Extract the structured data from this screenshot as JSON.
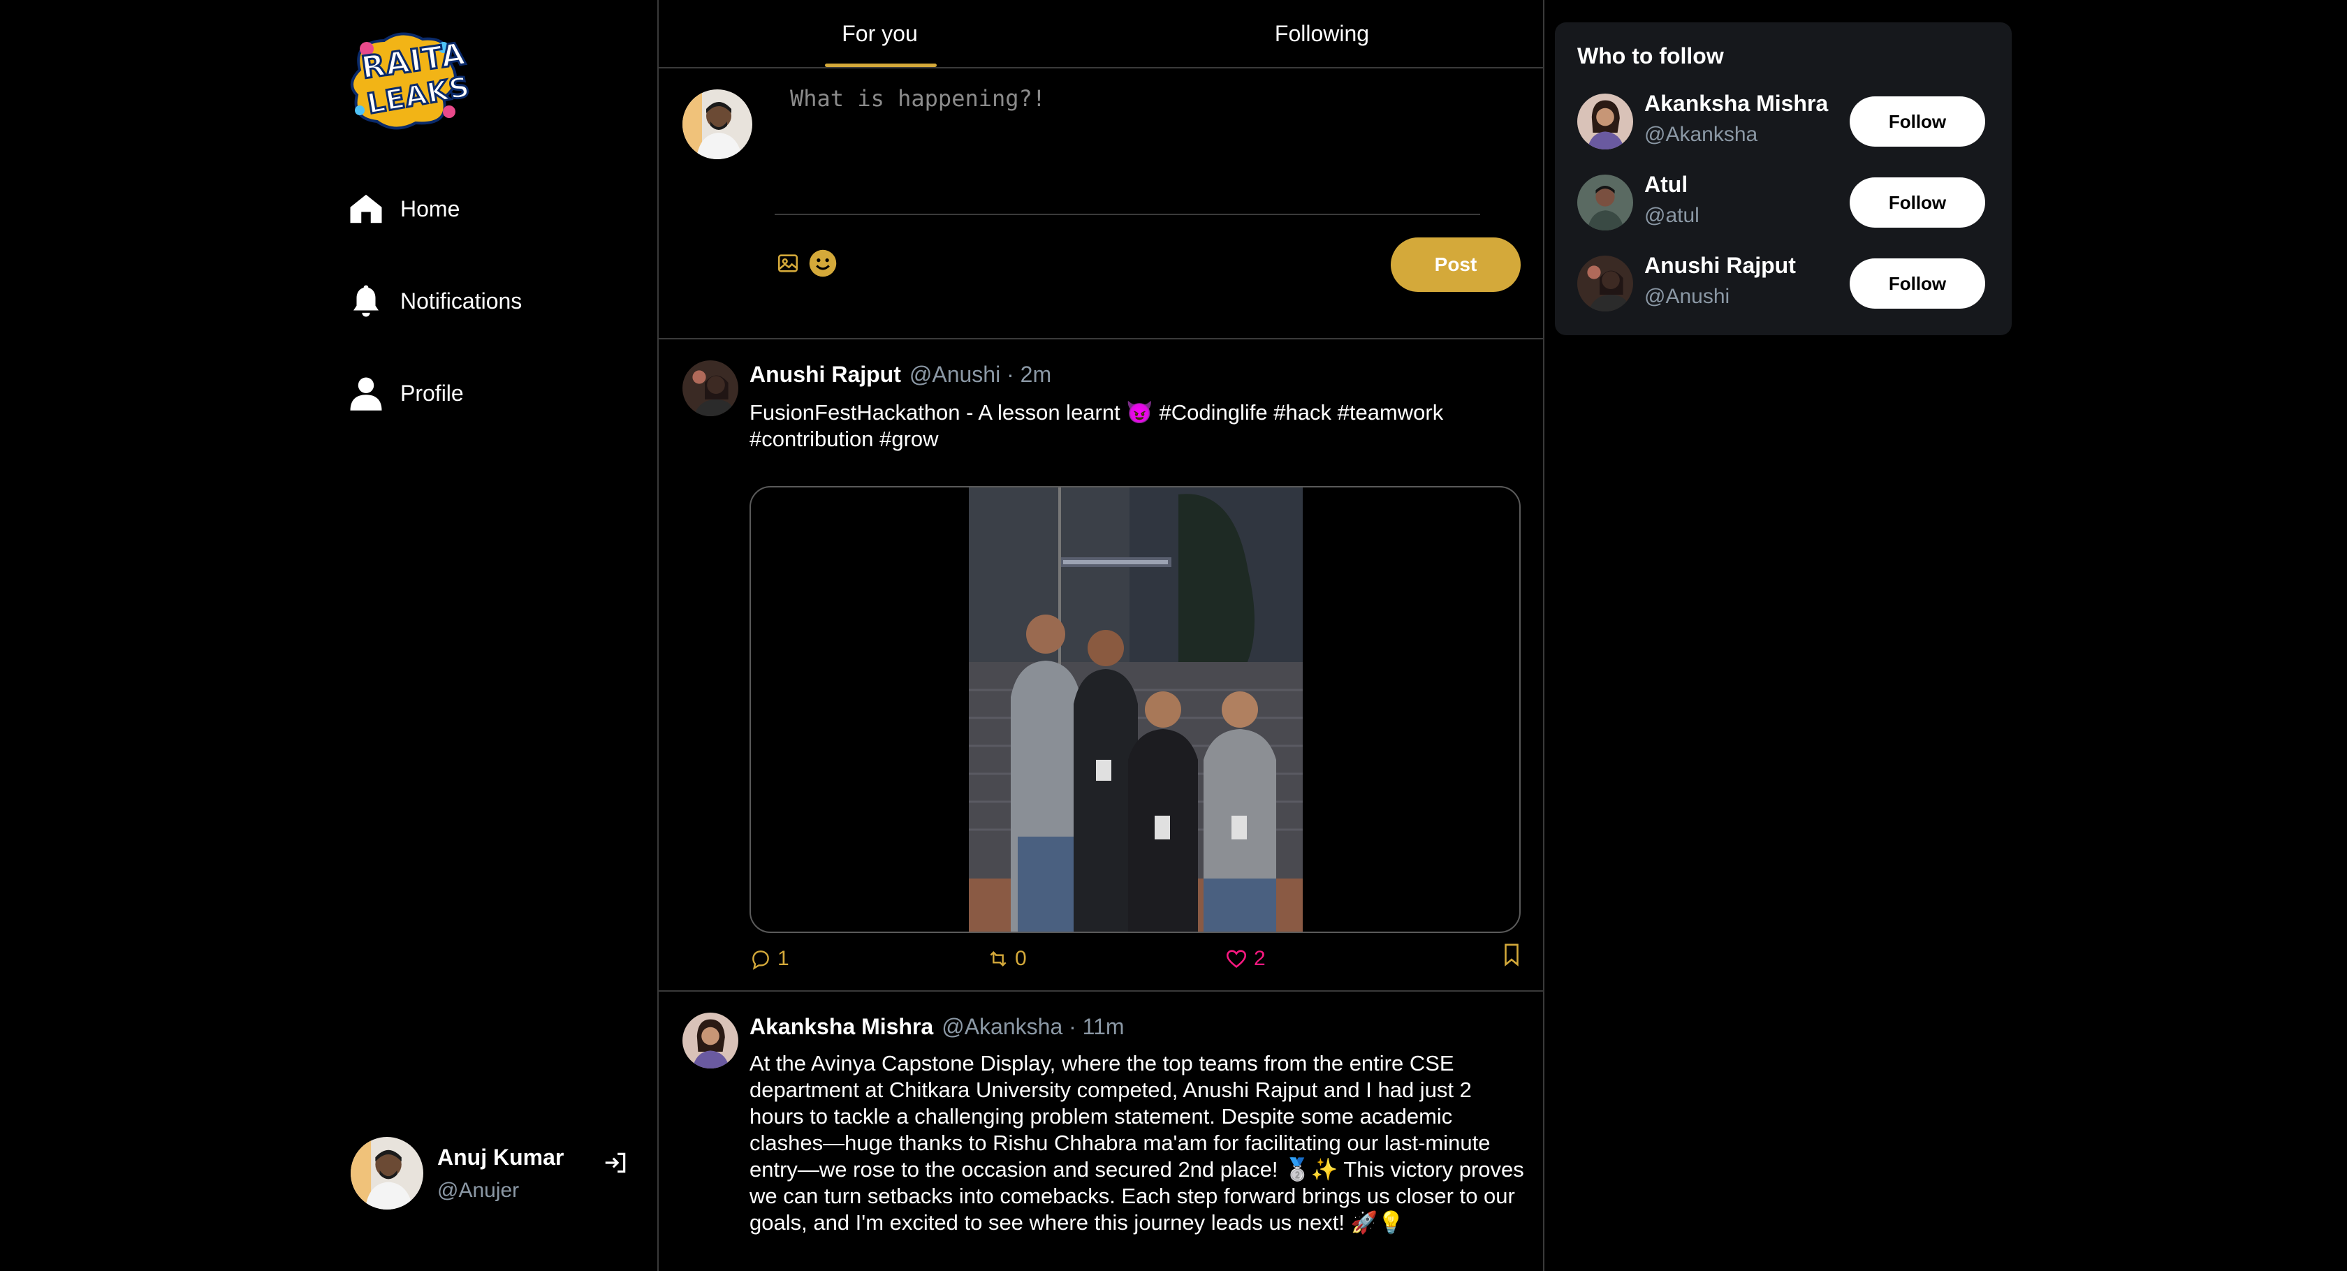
{
  "brand": {
    "logo_line1": "RAITA",
    "logo_line2": "LEAKS"
  },
  "nav": [
    {
      "label": "Home",
      "icon": "home-icon"
    },
    {
      "label": "Notifications",
      "icon": "bell-icon"
    },
    {
      "label": "Profile",
      "icon": "user-icon"
    }
  ],
  "current_user": {
    "name": "Anuj Kumar",
    "handle": "@Anujer"
  },
  "tabs": [
    {
      "label": "For you",
      "active": true
    },
    {
      "label": "Following",
      "active": false
    }
  ],
  "composer": {
    "placeholder": "What is happening?!",
    "post_label": "Post"
  },
  "colors": {
    "accent": "#d4a93a",
    "like": "#f91880",
    "muted": "#8b98a5"
  },
  "tweets": [
    {
      "name": "Anushi Rajput",
      "meta": "@Anushi · 2m",
      "text": "FusionFestHackathon - A lesson learnt 😈 #Codinglife #hack #teamwork #contribution #grow",
      "replies": "1",
      "retweets": "0",
      "likes": "2",
      "liked": true
    },
    {
      "name": "Akanksha Mishra",
      "meta": "@Akanksha · 11m",
      "text": "At the Avinya Capstone Display, where the top teams from the entire CSE department at Chitkara University competed, Anushi Rajput and I had just 2 hours to tackle a challenging problem statement. Despite some academic clashes—huge thanks to Rishu Chhabra ma'am for facilitating our last-minute entry—we rose to the occasion and secured 2nd place! 🥈✨ This victory proves we can turn setbacks into comebacks. Each step forward brings us closer to our goals, and I'm excited to see where this journey leads us next! 🚀💡"
    }
  ],
  "who_to_follow": {
    "title": "Who to follow",
    "users": [
      {
        "name": "Akanksha Mishra",
        "handle": "@Akanksha",
        "button": "Follow"
      },
      {
        "name": "Atul",
        "handle": "@atul",
        "button": "Follow"
      },
      {
        "name": "Anushi Rajput",
        "handle": "@Anushi",
        "button": "Follow"
      }
    ]
  }
}
